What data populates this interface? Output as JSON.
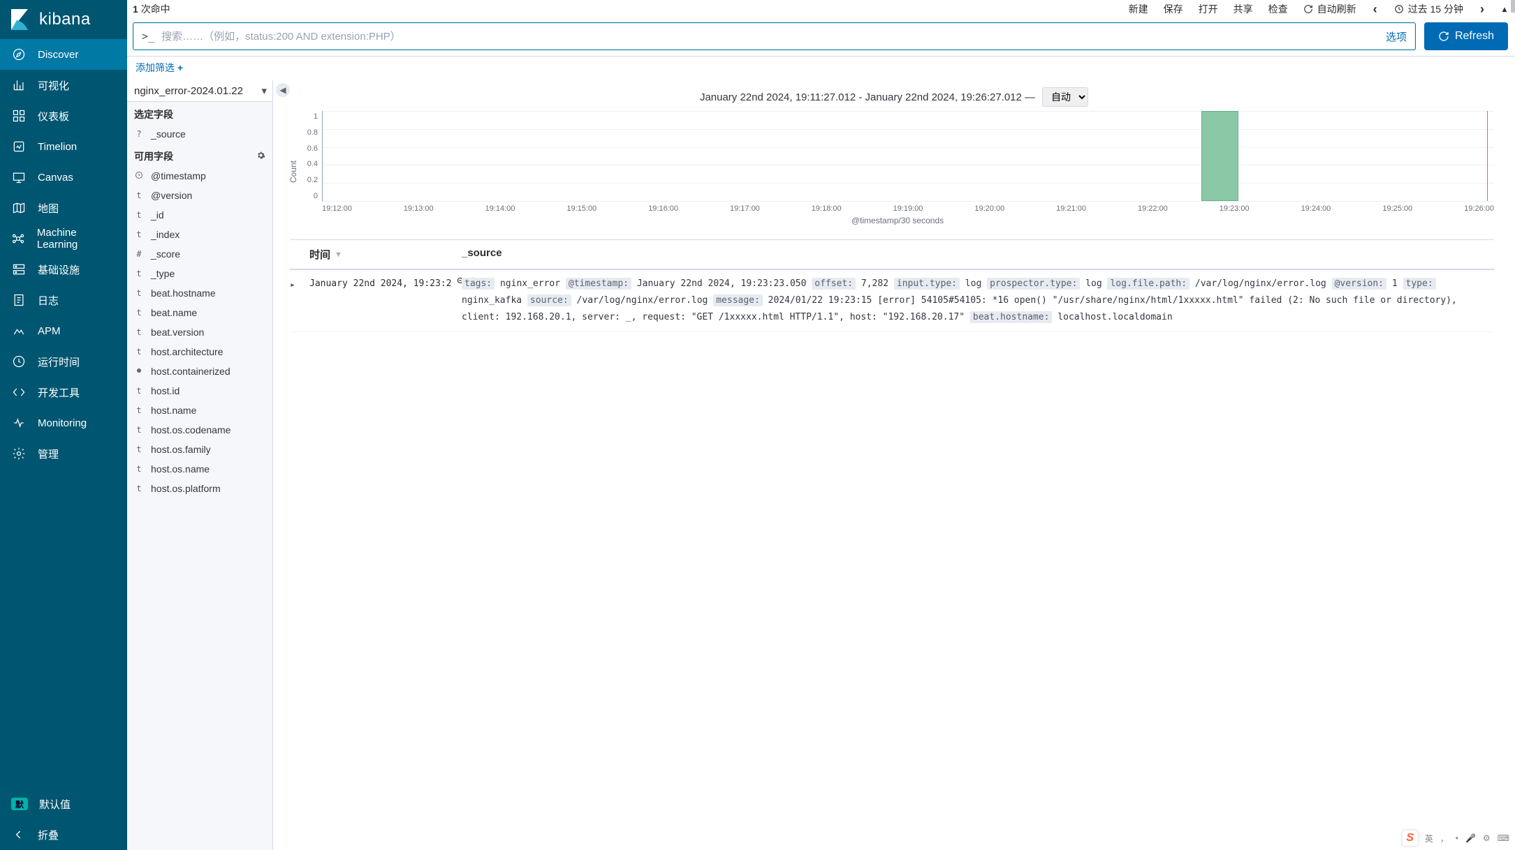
{
  "brand": "kibana",
  "sidebar": {
    "items": [
      {
        "label": "Discover",
        "icon": "compass"
      },
      {
        "label": "可视化",
        "icon": "chart"
      },
      {
        "label": "仪表板",
        "icon": "dashboard"
      },
      {
        "label": "Timelion",
        "icon": "timelion"
      },
      {
        "label": "Canvas",
        "icon": "canvas"
      },
      {
        "label": "地图",
        "icon": "map"
      },
      {
        "label": "Machine Learning",
        "icon": "ml"
      },
      {
        "label": "基础设施",
        "icon": "infra"
      },
      {
        "label": "日志",
        "icon": "logs"
      },
      {
        "label": "APM",
        "icon": "apm"
      },
      {
        "label": "运行时间",
        "icon": "uptime"
      },
      {
        "label": "开发工具",
        "icon": "dev"
      },
      {
        "label": "Monitoring",
        "icon": "monitor"
      },
      {
        "label": "管理",
        "icon": "gear"
      }
    ],
    "default_badge": "默",
    "default_label": "默认值",
    "collapse_label": "折叠"
  },
  "topbar": {
    "hits_count": "1",
    "hits_suffix": "次命中",
    "actions": [
      "新建",
      "保存",
      "打开",
      "共享",
      "检查"
    ],
    "auto_refresh": "自动刷新",
    "time_label": "过去 15 分钟",
    "search_prefix": ">_",
    "search_placeholder": "搜索……（例如，status:200 AND extension:PHP）",
    "options_label": "选项",
    "refresh_label": "Refresh",
    "add_filter": "添加筛选"
  },
  "fields_panel": {
    "index_pattern": "nginx_error-2024.01.22",
    "selected_title": "选定字段",
    "available_title": "可用字段",
    "selected": [
      {
        "type": "?",
        "name": "_source"
      }
    ],
    "available": [
      {
        "type": "clock",
        "name": "@timestamp"
      },
      {
        "type": "t",
        "name": "@version"
      },
      {
        "type": "t",
        "name": "_id"
      },
      {
        "type": "t",
        "name": "_index"
      },
      {
        "type": "#",
        "name": "_score"
      },
      {
        "type": "t",
        "name": "_type"
      },
      {
        "type": "t",
        "name": "beat.hostname"
      },
      {
        "type": "t",
        "name": "beat.name"
      },
      {
        "type": "t",
        "name": "beat.version"
      },
      {
        "type": "t",
        "name": "host.architecture"
      },
      {
        "type": "bool",
        "name": "host.containerized"
      },
      {
        "type": "t",
        "name": "host.id"
      },
      {
        "type": "t",
        "name": "host.name"
      },
      {
        "type": "t",
        "name": "host.os.codename"
      },
      {
        "type": "t",
        "name": "host.os.family"
      },
      {
        "type": "t",
        "name": "host.os.name"
      },
      {
        "type": "t",
        "name": "host.os.platform"
      }
    ]
  },
  "histogram": {
    "range_text": "January 22nd 2024, 19:11:27.012 - January 22nd 2024, 19:26:27.012 —",
    "interval_selected": "自动",
    "interval_options": [
      "自动"
    ],
    "y_label": "Count",
    "x_label": "@timestamp/30 seconds"
  },
  "chart_data": {
    "type": "bar",
    "ylabel": "Count",
    "xlabel": "@timestamp/30 seconds",
    "ylim": [
      0,
      1
    ],
    "yticks": [
      1,
      0.8,
      0.6,
      0.4,
      0.2,
      0
    ],
    "xticks": [
      "19:12:00",
      "19:13:00",
      "19:14:00",
      "19:15:00",
      "19:16:00",
      "19:17:00",
      "19:18:00",
      "19:19:00",
      "19:20:00",
      "19:21:00",
      "19:22:00",
      "19:23:00",
      "19:24:00",
      "19:25:00",
      "19:26:00"
    ],
    "bars": [
      {
        "x_center_pct": 76.6,
        "width_pct": 3.2,
        "value": 1
      }
    ],
    "marker_line_pct": 99.4
  },
  "doctable": {
    "col_time": "时间",
    "col_source": "_source",
    "rows": [
      {
        "time": "January 22nd 2024, 19:23:2",
        "kv": [
          {
            "k": "tags:",
            "v": "nginx_error"
          },
          {
            "k": "@timestamp:",
            "v": "January 22nd 2024, 19:23:23.050"
          },
          {
            "k": "offset:",
            "v": "7,282"
          },
          {
            "k": "input.type:",
            "v": "log"
          },
          {
            "k": "prospector.type:",
            "v": "log"
          },
          {
            "k": "log.file.path:",
            "v": "/var/log/nginx/error.log"
          },
          {
            "k": "@version:",
            "v": "1"
          },
          {
            "k": "type:",
            "v": "nginx_kafka"
          },
          {
            "k": "source:",
            "v": "/var/log/nginx/error.log"
          },
          {
            "k": "message:",
            "v": "2024/01/22 19:23:15 [error] 54105#54105: *16 open() \"/usr/share/nginx/html/1xxxxx.html\" failed (2: No such file or directory), client: 192.168.20.1, server: _, request: \"GET /1xxxxx.html HTTP/1.1\", host: \"192.168.20.17\""
          },
          {
            "k": "beat.hostname:",
            "v": "localhost.localdomain"
          }
        ]
      }
    ]
  },
  "ime": {
    "lang": "英",
    "punct": "，",
    "half": "•"
  }
}
